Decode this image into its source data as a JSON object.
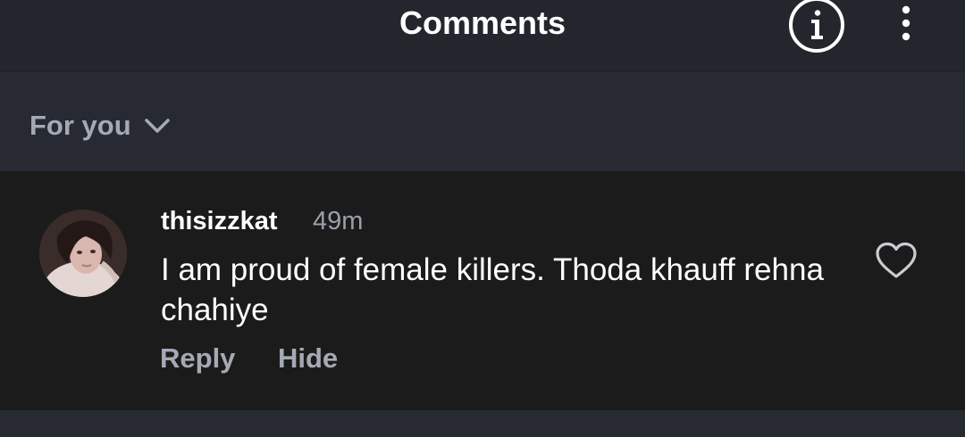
{
  "header": {
    "title": "Comments",
    "info_icon": "info-circle-icon",
    "more_icon": "vertical-ellipsis-icon"
  },
  "filter": {
    "label": "For you",
    "icon": "chevron-down-icon"
  },
  "comments": [
    {
      "username": "thisizzkat",
      "time": "49m",
      "text": "I am proud of female killers. Thoda khauff rehna chahiye",
      "reply_label": "Reply",
      "hide_label": "Hide",
      "like_icon": "heart-outline-icon"
    }
  ],
  "colors": {
    "background": "#23262d",
    "comment_background": "#1b1b1b",
    "filter_background": "#272a32",
    "secondary_text": "#a4aab5",
    "primary_text": "#ffffff"
  }
}
